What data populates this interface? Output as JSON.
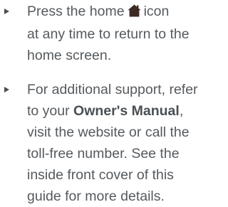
{
  "tips": {
    "home": {
      "line1_pre": "Press the home",
      "line1_post": "icon",
      "line2": "at any time to return to the",
      "line3": "home screen.",
      "icon": "home-icon"
    },
    "support": {
      "line1": "For additional support, refer",
      "line2_pre": "to your",
      "line2_bold": "Owner's Manual",
      "line2_post": ",",
      "line3": "visit the website or call the",
      "line4": "toll-free number. See the",
      "line5": "inside front cover of this",
      "line6": "guide for more details."
    }
  },
  "colors": {
    "text": "#555a5e",
    "bold_text": "#4a4f53",
    "icon": "#3d2a24"
  }
}
